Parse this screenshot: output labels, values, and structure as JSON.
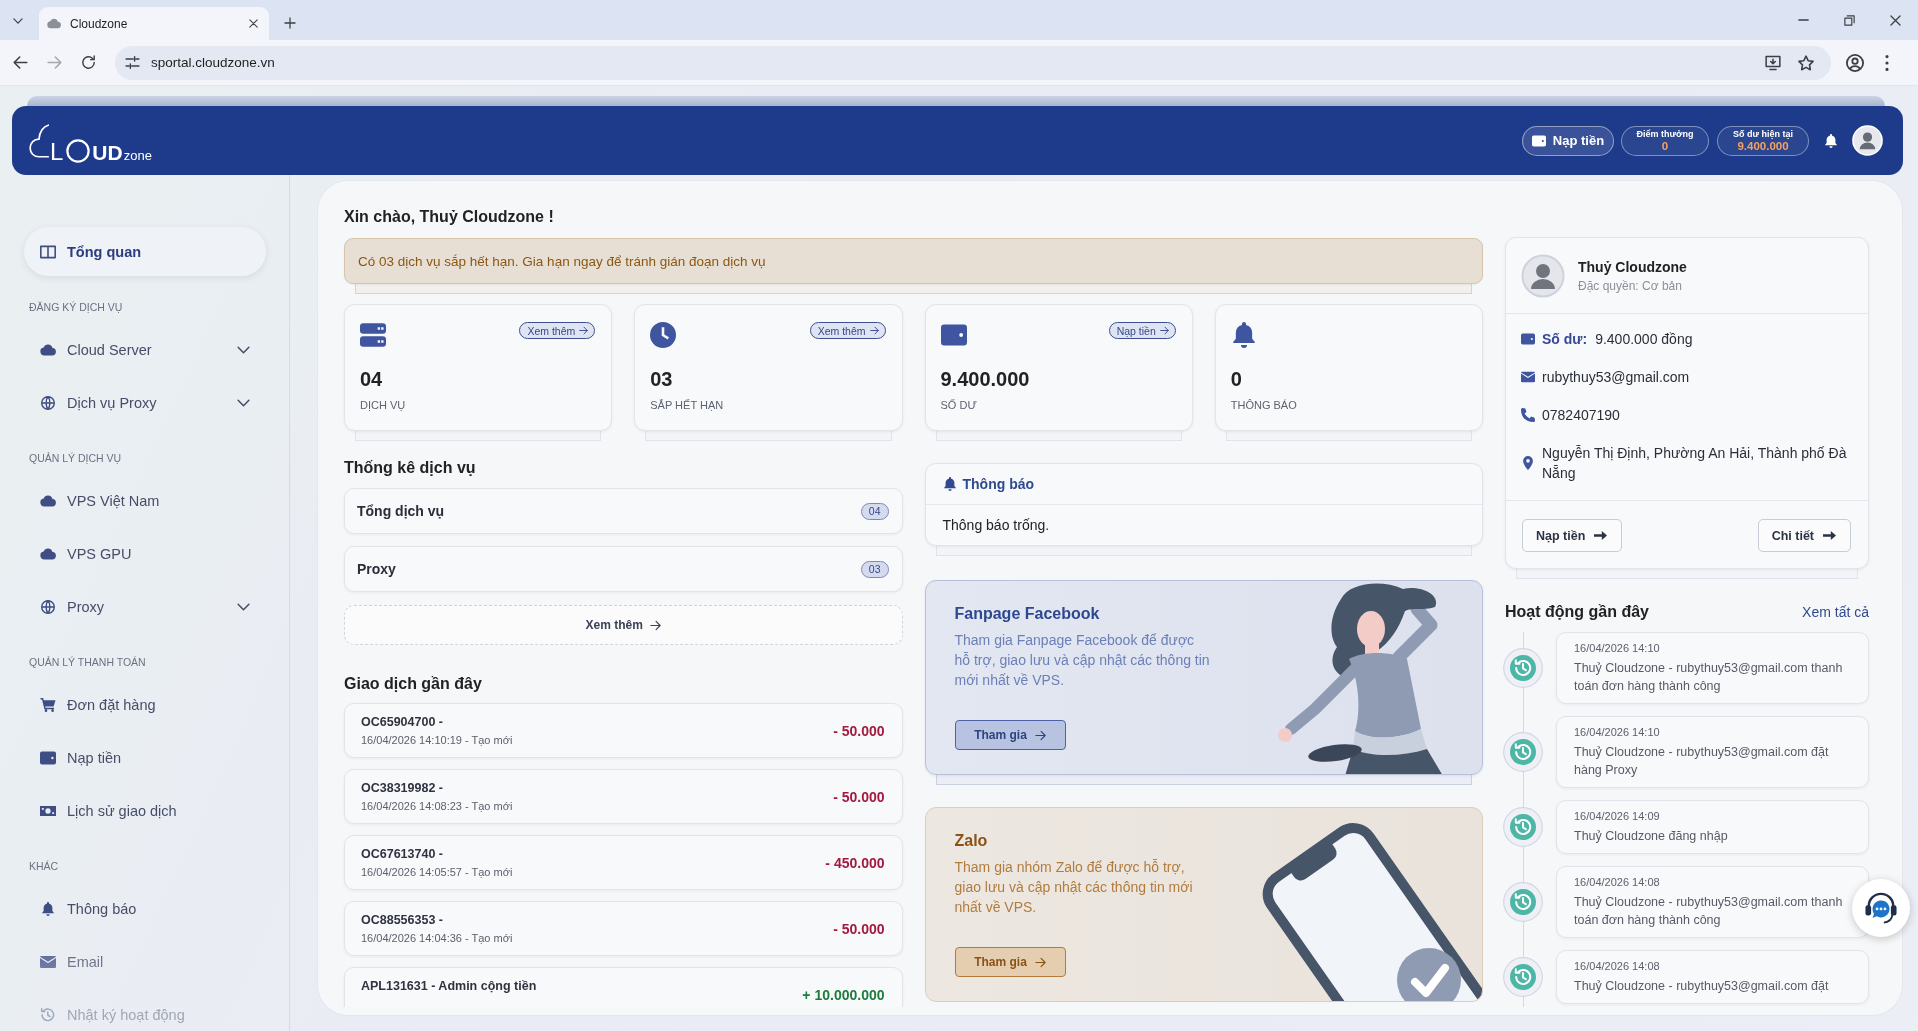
{
  "browser": {
    "tab": {
      "title": "Cloudzone",
      "selected": true
    },
    "back": {
      "disabled": false
    },
    "forward": {
      "disabled": true
    },
    "url": "sportal.cloudzone.vn"
  },
  "header": {
    "logo": {
      "lead": "L",
      "strong": "UD",
      "tail": "zone"
    },
    "topup_button": "Nạp tiền",
    "points": {
      "label": "Điểm thưởng",
      "value": "0"
    },
    "balance": {
      "label": "Số dư hiện tại",
      "value": "9.400.000"
    }
  },
  "sidebar": {
    "sections": [
      {
        "items": [
          {
            "label": "Tổng quan",
            "kind": "link",
            "selected": true
          }
        ]
      },
      {
        "title": "ĐĂNG KÝ DỊCH VỤ",
        "items": [
          {
            "label": "Cloud Server",
            "kind": "group",
            "selected": false
          },
          {
            "label": "Dịch vụ Proxy",
            "kind": "group",
            "selected": false
          }
        ]
      },
      {
        "title": "QUẢN LÝ DỊCH VỤ",
        "items": [
          {
            "label": "VPS Việt Nam",
            "kind": "link",
            "selected": false
          },
          {
            "label": "VPS GPU",
            "kind": "link",
            "selected": false
          },
          {
            "label": "Proxy",
            "kind": "group",
            "selected": false
          }
        ]
      },
      {
        "title": "QUẢN LÝ THANH TOÁN",
        "items": [
          {
            "label": "Đơn đặt hàng",
            "kind": "link",
            "selected": false
          },
          {
            "label": "Nạp tiền",
            "kind": "link",
            "selected": false
          },
          {
            "label": "Lịch sử giao dịch",
            "kind": "link",
            "selected": false
          }
        ]
      },
      {
        "title": "KHÁC",
        "items": [
          {
            "label": "Thông báo",
            "kind": "link",
            "selected": false
          },
          {
            "label": "Email",
            "kind": "link",
            "selected": false
          },
          {
            "label": "Nhật ký hoạt động",
            "kind": "link",
            "selected": false
          }
        ]
      }
    ]
  },
  "greeting": "Xin chào, Thuỷ Cloudzone !",
  "alert": "Có 03 dịch vụ sắp hết hạn. Gia hạn ngay để tránh gián đoạn dịch vụ",
  "stats": [
    {
      "value": "04",
      "label": "DỊCH VỤ",
      "link": "Xem thêm"
    },
    {
      "value": "03",
      "label": "SẮP HẾT HẠN",
      "link": "Xem thêm"
    },
    {
      "value": "9.400.000",
      "label": "SỐ DƯ",
      "link": "Nạp tiền"
    },
    {
      "value": "0",
      "label": "THÔNG BÁO"
    }
  ],
  "service_stats": {
    "title": "Thống kê dịch vụ",
    "rows": [
      {
        "name": "Tổng dịch vụ",
        "count": "04"
      },
      {
        "name": "Proxy",
        "count": "03"
      }
    ],
    "more_button": "Xem thêm"
  },
  "transactions": {
    "title": "Giao dịch gần đây",
    "items": [
      {
        "code": "OC65904700 -",
        "meta": "16/04/2026 14:10:19 - Tạo mới",
        "amount": "- 50.000",
        "kind": "debit"
      },
      {
        "code": "OC38319982 -",
        "meta": "16/04/2026 14:08:23 - Tạo mới",
        "amount": "- 50.000",
        "kind": "debit"
      },
      {
        "code": "OC67613740 -",
        "meta": "16/04/2026 14:05:57 - Tạo mới",
        "amount": "- 450.000",
        "kind": "debit"
      },
      {
        "code": "OC88556353 -",
        "meta": "16/04/2026 14:04:36 - Tạo mới",
        "amount": "- 50.000",
        "kind": "debit"
      },
      {
        "code": "APL131631 - Admin cộng tiền",
        "amount": "+ 10.000.000",
        "kind": "credit"
      }
    ]
  },
  "notifications": {
    "title": "Thông báo",
    "empty_text": "Thông báo trống."
  },
  "promos": [
    {
      "kind": "facebook",
      "title": "Fanpage Facebook",
      "text": "Tham gia Fanpage Facebook để được hỗ trợ, giao lưu và cập nhật các thông tin mới nhất về VPS.",
      "button": "Tham gia"
    },
    {
      "kind": "zalo",
      "title": "Zalo",
      "text": "Tham gia nhóm Zalo để được hỗ trợ, giao lưu và cập nhật các thông tin mới nhất về VPS.",
      "button": "Tham gia"
    }
  ],
  "profile": {
    "name": "Thuỷ Cloudzone",
    "role": "Đặc quyền: Cơ bản",
    "balance_label": "Số dư:",
    "balance": "9.400.000 đồng",
    "email": "rubythuy53@gmail.com",
    "phone": "0782407190",
    "address": "Nguyễn Thị Định, Phường An Hải, Thành phố Đà Nẵng",
    "buttons": [
      {
        "label": "Nạp tiền"
      },
      {
        "label": "Chi tiết"
      }
    ]
  },
  "activity": {
    "title": "Hoạt động gần đây",
    "view_all": "Xem tất cả",
    "items": [
      {
        "time": "16/04/2026 14:10",
        "text": "Thuỷ Cloudzone - rubythuy53@gmail.com thanh toán đơn hàng thành công"
      },
      {
        "time": "16/04/2026 14:10",
        "text": "Thuỷ Cloudzone - rubythuy53@gmail.com đặt hàng Proxy"
      },
      {
        "time": "16/04/2026 14:09",
        "text": "Thuỷ Cloudzone đăng nhập"
      },
      {
        "time": "16/04/2026 14:08",
        "text": "Thuỷ Cloudzone - rubythuy53@gmail.com thanh toán đơn hàng thành công"
      },
      {
        "time": "16/04/2026 14:08",
        "text": "Thuỷ Cloudzone - rubythuy53@gmail.com đặt"
      }
    ]
  }
}
